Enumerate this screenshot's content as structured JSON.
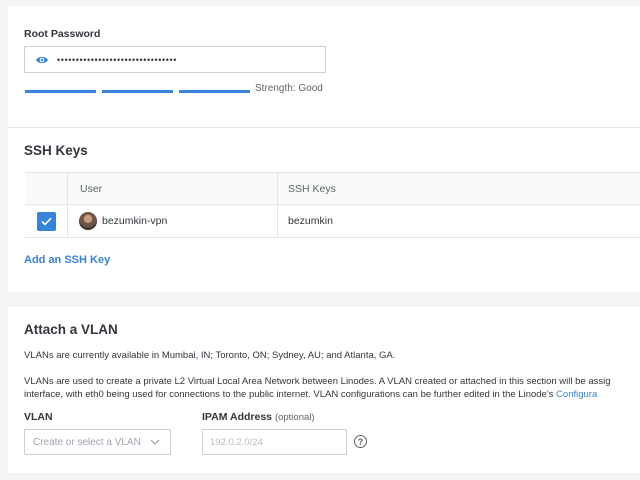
{
  "password": {
    "label": "Root Password",
    "masked_value": "••••••••••••••••••••••••••••••••",
    "strength_text": "Strength: Good",
    "strength_level": 3
  },
  "ssh": {
    "title": "SSH Keys",
    "columns": [
      "User",
      "SSH Keys"
    ],
    "rows": [
      {
        "user": "bezumkin-vpn",
        "key": "bezumkin",
        "checked": true
      }
    ],
    "add_link": "Add an SSH Key"
  },
  "vlan": {
    "title": "Attach a VLAN",
    "availability": "VLANs are currently available in Mumbai, IN; Toronto, ON; Sydney, AU; and Atlanta, GA.",
    "description_line1": "VLANs are used to create a private L2 Virtual Local Area Network between Linodes. A VLAN created or attached in this section will be assig",
    "description_line2": "interface, with eth0 being used for connections to the public internet. VLAN configurations can be further edited in the Linode's ",
    "description_link": "Configura",
    "vlan_label": "VLAN",
    "vlan_placeholder": "Create or select a VLAN",
    "ipam_label": "IPAM Address",
    "ipam_optional": "(optional)",
    "ipam_placeholder": "192.0.2.0/24"
  },
  "colors": {
    "accent": "#3683dc",
    "text": "#32363c",
    "border": "#e3e5e8"
  },
  "icons": [
    "eye-icon",
    "check-icon",
    "chevron-down-icon",
    "help-icon"
  ]
}
